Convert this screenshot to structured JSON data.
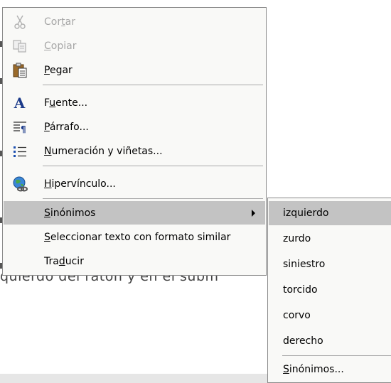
{
  "document": {
    "text_fragment": "quierdo del ratón y en el subm"
  },
  "menu": {
    "items": [
      {
        "label": "Cortar",
        "underline_index": 3,
        "icon": "scissors-icon",
        "disabled": true
      },
      {
        "label": "Copiar",
        "underline_index": 0,
        "icon": "copy-icon",
        "disabled": true
      },
      {
        "label": "Pegar",
        "underline_index": 0,
        "icon": "paste-icon",
        "disabled": false
      },
      {
        "label": "Fuente...",
        "underline_index": 1,
        "icon": "font-icon",
        "disabled": false
      },
      {
        "label": "Párrafo...",
        "underline_index": 0,
        "icon": "paragraph-icon",
        "disabled": false
      },
      {
        "label": "Numeración y viñetas...",
        "underline_index": 0,
        "icon": "list-icon",
        "disabled": false
      },
      {
        "label": "Hipervínculo...",
        "underline_index": 0,
        "icon": "hyperlink-icon",
        "disabled": false
      },
      {
        "label": "Sinónimos",
        "underline_index": 0,
        "has_submenu": true,
        "highlighted": true
      },
      {
        "label": "Seleccionar texto con formato similar",
        "underline_index": 0
      },
      {
        "label": "Traducir",
        "underline_index": 3
      }
    ]
  },
  "submenu": {
    "items": [
      {
        "label": "izquierdo",
        "highlighted": true
      },
      {
        "label": "zurdo"
      },
      {
        "label": "siniestro"
      },
      {
        "label": "torcido"
      },
      {
        "label": "corvo"
      },
      {
        "label": "derecho"
      },
      {
        "label": "Sinónimos...",
        "underline_index": 0
      }
    ]
  },
  "colors": {
    "highlight": "#c3c3c3",
    "menu_bg": "#f9f9f7",
    "disabled_text": "#a6a6a6"
  }
}
